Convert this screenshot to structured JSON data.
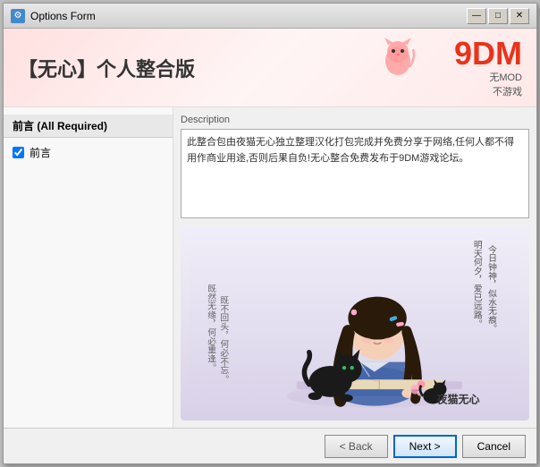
{
  "window": {
    "title": "Options Form",
    "icon": "⚙",
    "controls": {
      "minimize": "—",
      "maximize": "□",
      "close": "✕"
    }
  },
  "header": {
    "title": "【无心】个人整合版",
    "logo_text": "9DM",
    "logo_sub1": "无MOD",
    "logo_sub2": "不游戏"
  },
  "left_panel": {
    "section_title": "前言 (All Required)",
    "items": [
      {
        "label": "前言",
        "checked": true
      }
    ]
  },
  "right_panel": {
    "description_label": "Description",
    "description_text": "此整合包由夜猫无心独立整理汉化打包完成并免费分享于网络,任何人都不得用作商业用途,否则后果自负!无心整合免费发布于9DM游戏论坛。"
  },
  "illustration": {
    "text_left_1": "既然无缘，何必重逢。",
    "text_left_2": "既不回头，何必不忘。",
    "text_right_1": "明天何夕，爱已远路。",
    "text_right_2": "今日钟神，似水无痕。",
    "watermark": "夜猫无心"
  },
  "footer": {
    "back_label": "< Back",
    "next_label": "Next >",
    "cancel_label": "Cancel"
  }
}
